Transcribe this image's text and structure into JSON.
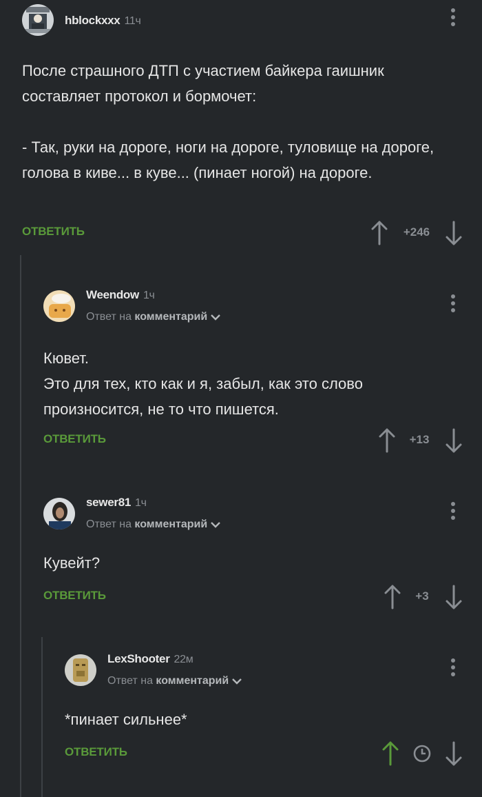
{
  "comments": [
    {
      "author": "hblockxxx",
      "time": "11ч",
      "text": "После страшного ДТП с участием байкера гаишник составляет протокол и бормочет:\n\n- Так, руки на дороге, ноги на дороге, туловище на дороге, голова в киве... в куве... (пинает ногой) на дороге.",
      "reply_label": "ОТВЕТИТЬ",
      "score": "+246"
    },
    {
      "author": "Weendow",
      "time": "1ч",
      "reply_prefix": "Ответ на",
      "reply_target": "комментарий",
      "text": "Кювет.\nЭто для тех, кто как и я, забыл, как это слово произносится, не то что пишется.",
      "reply_label": "ОТВЕТИТЬ",
      "score": "+13"
    },
    {
      "author": "sewer81",
      "time": "1ч",
      "reply_prefix": "Ответ на",
      "reply_target": "комментарий",
      "text": "Кувейт?",
      "reply_label": "ОТВЕТИТЬ",
      "score": "+3"
    },
    {
      "author": "LexShooter",
      "time": "22м",
      "reply_prefix": "Ответ на",
      "reply_target": "комментарий",
      "text": "*пинает сильнее*",
      "reply_label": "ОТВЕТИТЬ",
      "score": ""
    }
  ],
  "colors": {
    "background": "#24272a",
    "accent_green": "#5a9a3a",
    "muted": "#8a8e93",
    "text": "#e6e6e6"
  },
  "icons": [
    "kebab-menu-icon",
    "upvote-arrow-icon",
    "downvote-arrow-icon",
    "chevron-down-icon",
    "clock-icon"
  ]
}
